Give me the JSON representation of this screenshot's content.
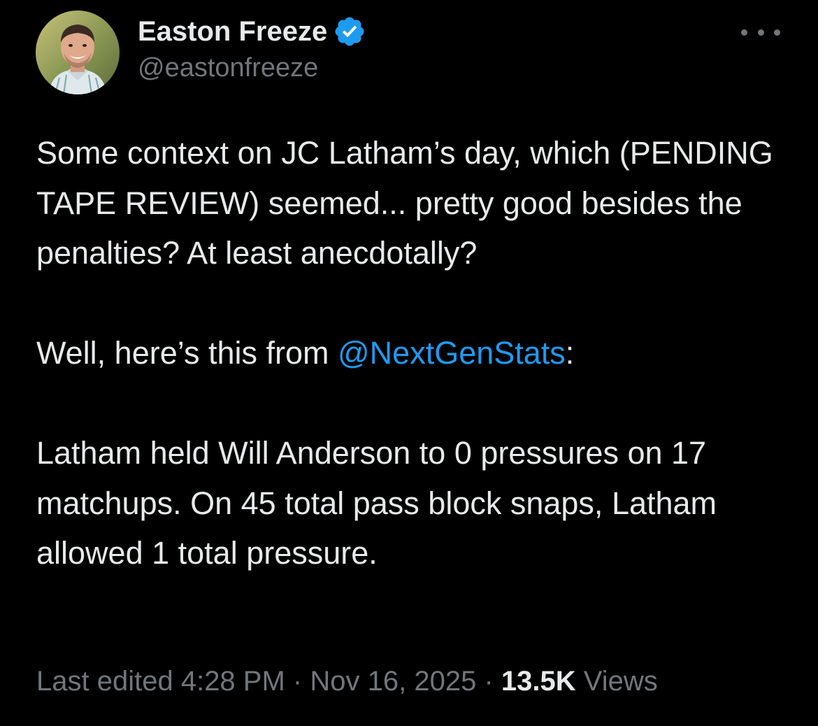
{
  "author": {
    "display_name": "Easton Freeze",
    "handle": "@eastonfreeze",
    "verified": true
  },
  "tweet": {
    "paragraph1": "Some context on JC Latham’s day, which (PENDING TAPE REVIEW) seemed... pretty good besides the penalties? At least anecdotally?",
    "paragraph2_prefix": "Well, here’s this from ",
    "paragraph2_mention": "@NextGenStats",
    "paragraph2_suffix": ":",
    "paragraph3": "Latham held Will Anderson to 0 pressures on 17 matchups. On 45 total pass block snaps, Latham allowed 1 total pressure."
  },
  "meta": {
    "edited_label": "Last edited",
    "time": "4:28 PM",
    "separator": "·",
    "date": "Nov 16, 2025",
    "views_count": "13.5K",
    "views_label": "Views"
  },
  "icons": {
    "verified": "verified-badge-icon",
    "more": "more-horizontal-icon"
  },
  "colors": {
    "background": "#000000",
    "text_primary": "#e7e9ea",
    "text_secondary": "#71767b",
    "accent": "#1d9bf0"
  }
}
